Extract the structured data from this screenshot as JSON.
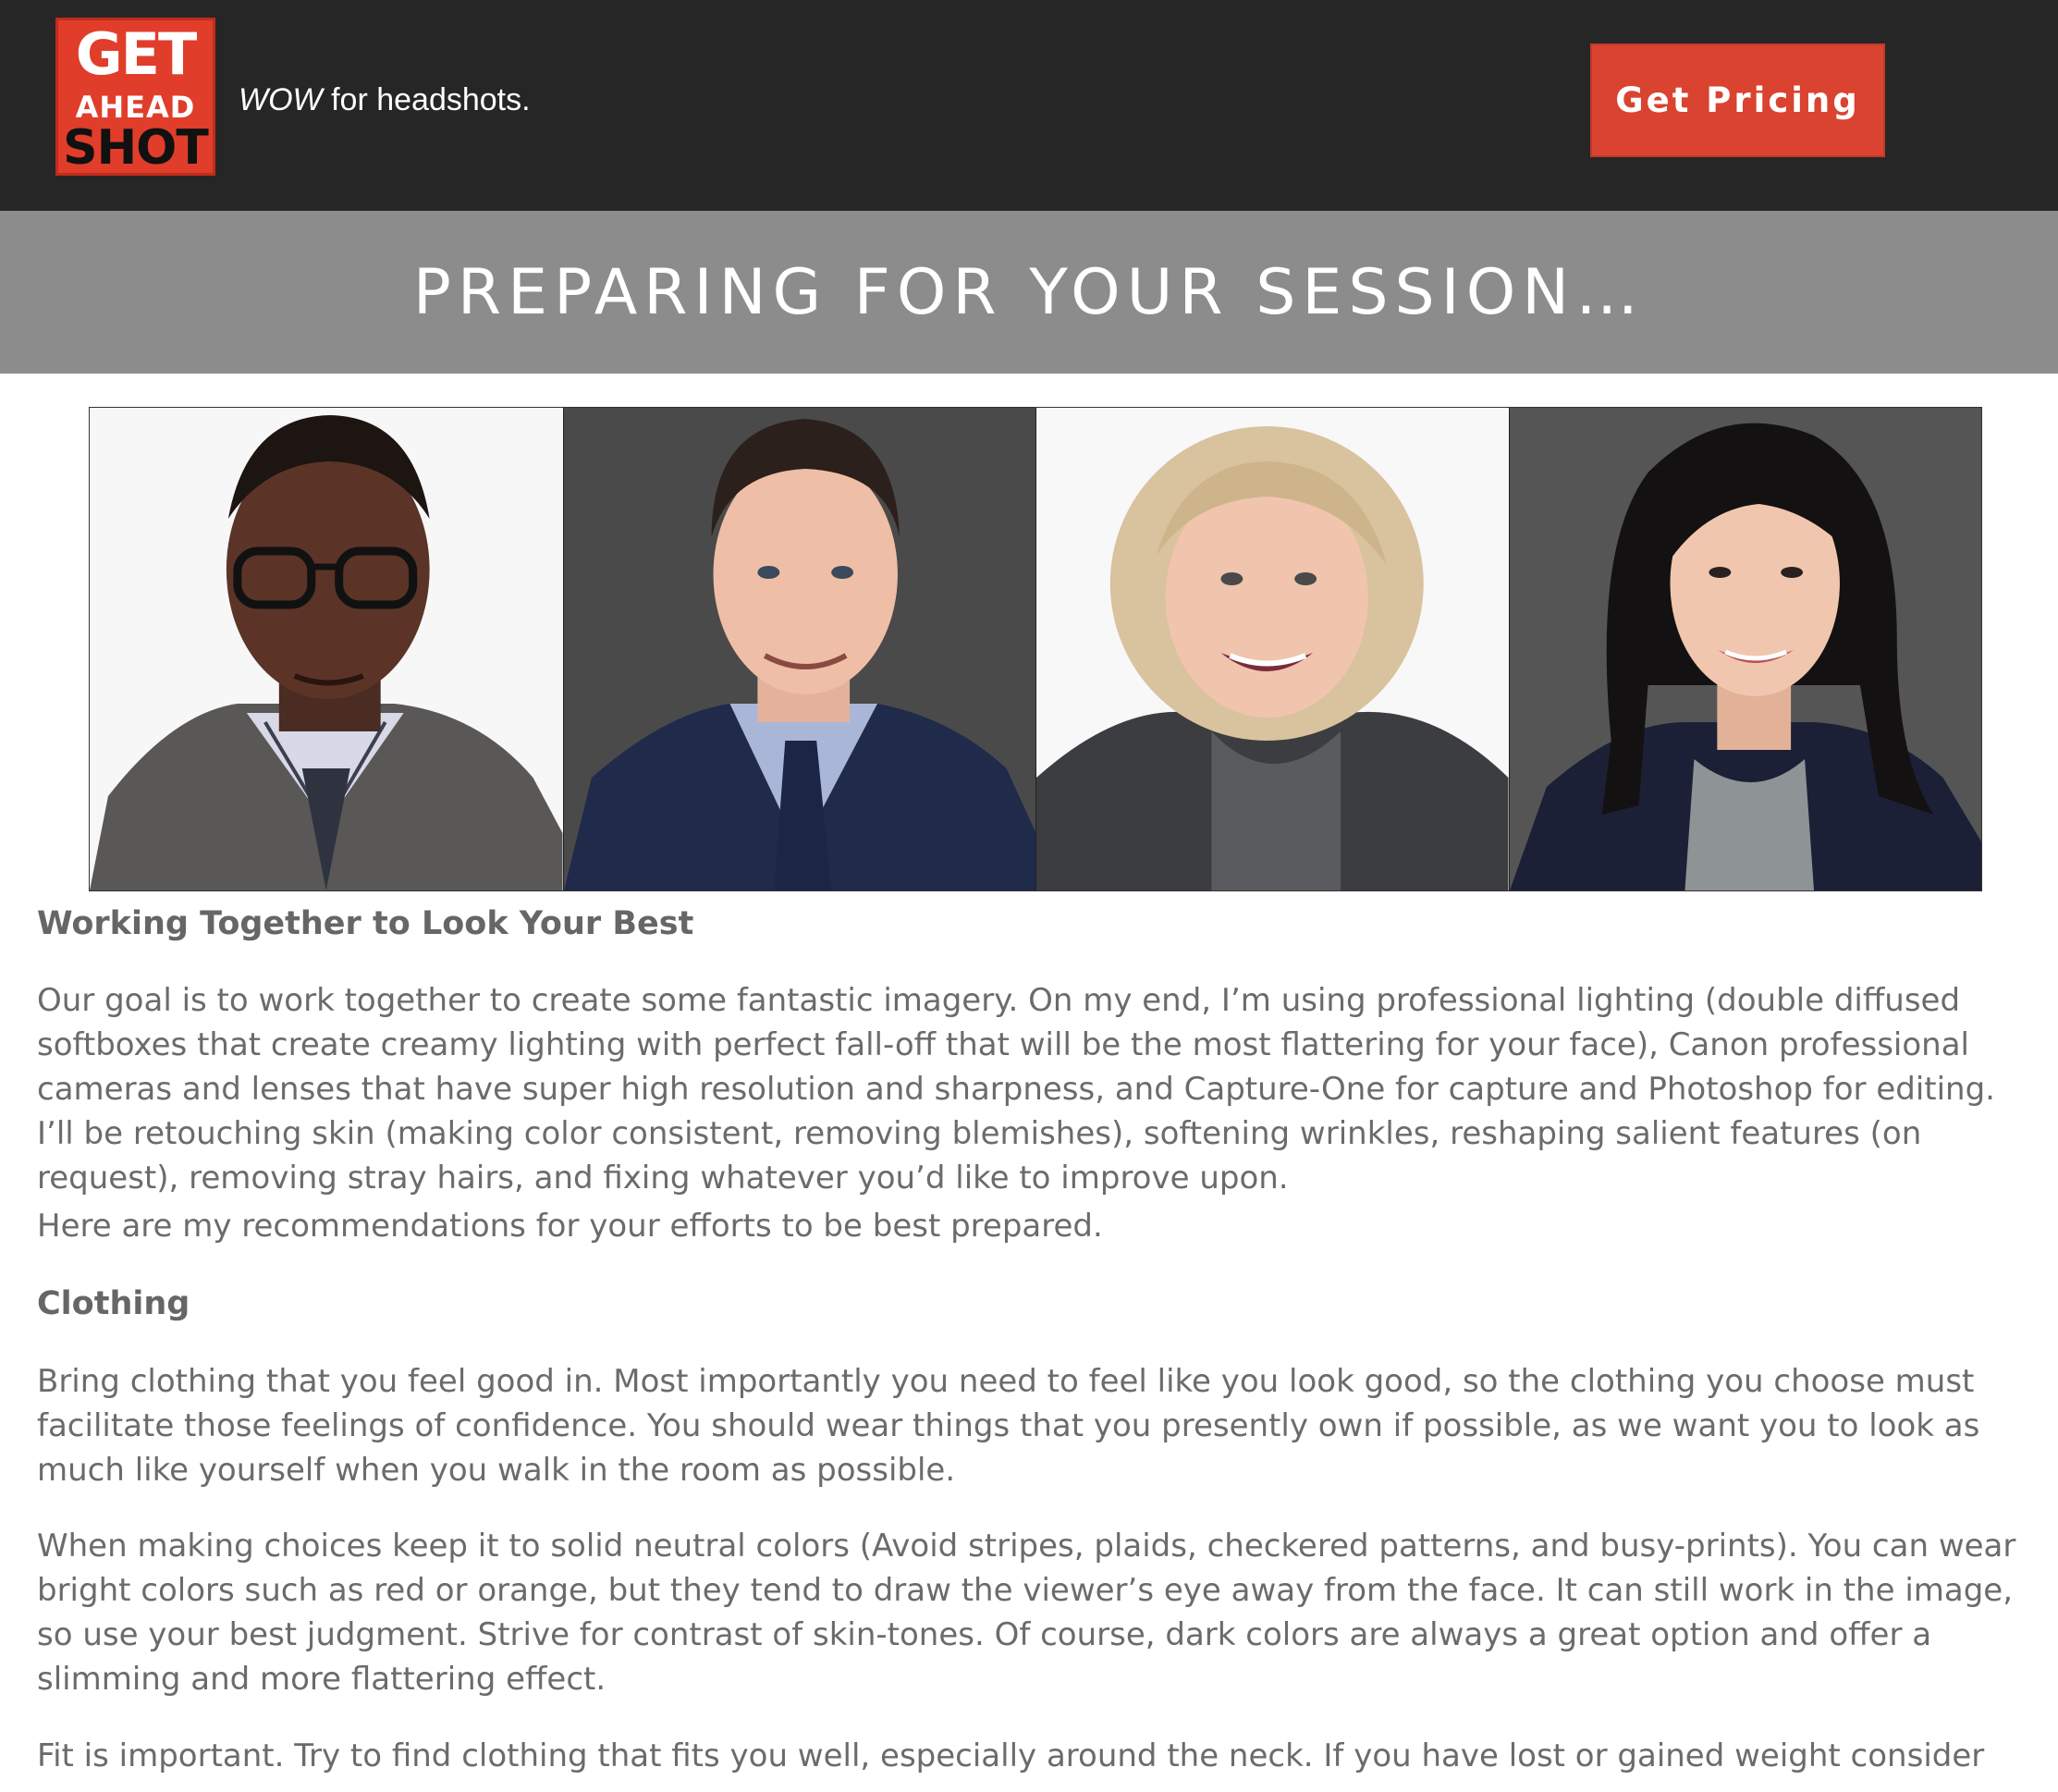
{
  "header": {
    "logo": {
      "line1": "GET",
      "line2": "AHEAD",
      "line3": "SHOT"
    },
    "tagline_em": "WOW",
    "tagline_rest": " for headshots.",
    "cta_label": "Get Pricing"
  },
  "banner": {
    "title": "PREPARING FOR YOUR SESSION…"
  },
  "colors": {
    "header_bg": "#262626",
    "accent": "#d9432f",
    "banner_bg": "#8c8c8c",
    "body_text": "#6b6b6b"
  },
  "article": {
    "heading1": "Working Together to Look Your Best",
    "para1": "Our goal is to work together to create some fantastic imagery. On my end, I’m using professional lighting (double diffused softboxes that create creamy lighting with perfect fall-off that will be the most flattering for your face), Canon professional cameras and lenses that have super high resolution and sharpness, and Capture-One for capture and Photoshop for editing. I’ll be retouching skin (making color consistent, removing blemishes), softening wrinkles, reshaping salient features (on request), removing stray hairs, and fixing whatever you’d like to improve upon.",
    "para2": "Here are my recommendations for your efforts to be best prepared.",
    "heading2": "Clothing",
    "para3": "Bring clothing that you feel good in. Most importantly you need to feel like you look good, so the clothing you choose must facilitate those feelings of confidence. You should wear things that you presently own if possible, as we want you to look as much like yourself when you walk in the room as possible.",
    "para4": "When making choices keep it to solid neutral colors (Avoid stripes, plaids, checkered patterns, and busy-prints). You can wear bright colors such as red or orange, but they tend to draw the viewer’s eye away from the face. It can still work in the image, so use your best judgment. Strive for contrast of skin-tones. Of course, dark colors are always a great option and offer a slimming and more flattering effect.",
    "para5": "Fit is important. Try to find clothing that fits you well, especially around the neck. If you have lost or gained weight consider"
  }
}
